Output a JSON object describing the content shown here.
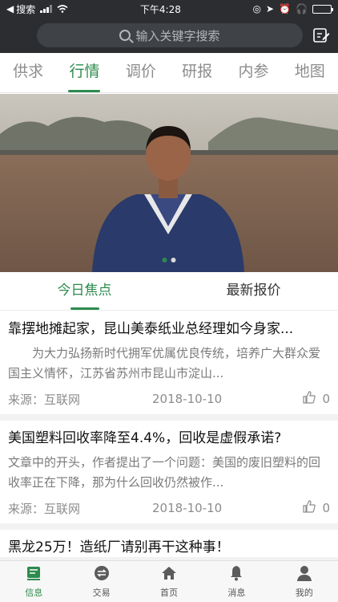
{
  "status": {
    "carrier": "搜索",
    "time": "下午4:28"
  },
  "header": {
    "search_placeholder": "输入关键字搜索",
    "edit_icon": "edit-icon"
  },
  "tabs": [
    {
      "label": "供求"
    },
    {
      "label": "行情",
      "active": true
    },
    {
      "label": "调价"
    },
    {
      "label": "研报"
    },
    {
      "label": "内参"
    },
    {
      "label": "地图"
    }
  ],
  "banner": {
    "slide_count": 2,
    "active_slide": 1
  },
  "subtabs": [
    {
      "label": "今日焦点",
      "active": true
    },
    {
      "label": "最新报价"
    }
  ],
  "articles": [
    {
      "title": "靠摆地摊起家，昆山美泰纸业总经理如今身家...",
      "summary": "为大力弘扬新时代拥军优属优良传统，培养广大群众爱国主义情怀，江苏省苏州市昆山市淀山...",
      "source": "来源：互联网",
      "date": "2018-10-10",
      "likes": "0"
    },
    {
      "title": "美国塑料回收率降至4.4%，回收是虚假承诺?",
      "summary": "文章中的开头，作者提出了一个问题：美国的废旧塑料的回收率正在下降，那为什么回收仍然被作...",
      "source": "来源：互联网",
      "date": "2018-10-10",
      "likes": "0"
    },
    {
      "title": "黑龙25万！造纸厂请别再干这种事！",
      "summary": "",
      "source": "",
      "date": "",
      "likes": ""
    }
  ],
  "bottom_nav": [
    {
      "label": "信息",
      "icon": "info-icon",
      "active": true
    },
    {
      "label": "交易",
      "icon": "exchange-icon"
    },
    {
      "label": "首页",
      "icon": "home-icon"
    },
    {
      "label": "消息",
      "icon": "bell-icon"
    },
    {
      "label": "我的",
      "icon": "user-icon"
    }
  ],
  "colors": {
    "accent": "#2e8b4e",
    "header_bg": "#2b2d30"
  }
}
